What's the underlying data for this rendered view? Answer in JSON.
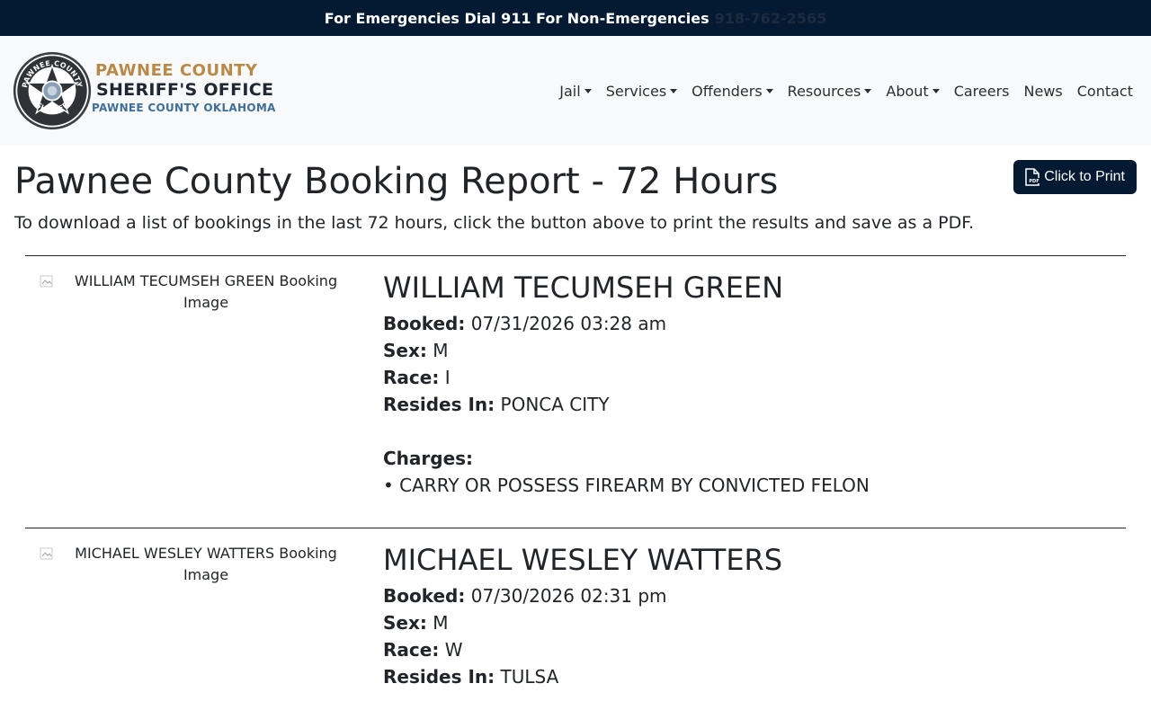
{
  "topbar": {
    "emergency_text": "For Emergencies Dial 911 For Non-Emergencies",
    "phone": "918-762-2565"
  },
  "brand": {
    "line1": "PAWNEE COUNTY",
    "line2": "SHERIFF'S OFFICE",
    "line3": "PAWNEE COUNTY OKLAHOMA",
    "seal_text_top": "PAWNEE COUNTY",
    "seal_text_bottom": "SHERIFF"
  },
  "nav": {
    "items": [
      {
        "label": "Jail",
        "dropdown": true
      },
      {
        "label": "Services",
        "dropdown": true
      },
      {
        "label": "Offenders",
        "dropdown": true
      },
      {
        "label": "Resources",
        "dropdown": true
      },
      {
        "label": "About",
        "dropdown": true
      },
      {
        "label": "Careers",
        "dropdown": false
      },
      {
        "label": "News",
        "dropdown": false
      },
      {
        "label": "Contact",
        "dropdown": false
      }
    ]
  },
  "page": {
    "title": "Pawnee County Booking Report - 72 Hours",
    "print_button": "Click to Print",
    "instructions": "To download a list of bookings in the last 72 hours, click the button above to print the results and save as a PDF."
  },
  "labels": {
    "booked": "Booked:",
    "sex": "Sex:",
    "race": "Race:",
    "resides": "Resides In:",
    "charges": "Charges:"
  },
  "records": [
    {
      "image_alt": "WILLIAM TECUMSEH GREEN Booking Image",
      "name": "WILLIAM TECUMSEH GREEN",
      "booked": "07/31/2026 03:28 am",
      "sex": "M",
      "race": "I",
      "resides": "PONCA CITY",
      "charges": [
        "• CARRY OR POSSESS FIREARM BY CONVICTED FELON"
      ]
    },
    {
      "image_alt": "MICHAEL WESLEY WATTERS Booking Image",
      "name": "MICHAEL WESLEY WATTERS",
      "booked": "07/30/2026 02:31 pm",
      "sex": "M",
      "race": "W",
      "resides": "TULSA",
      "charges": []
    }
  ],
  "colors": {
    "navy": "#041a33",
    "gold": "#b98948",
    "steel_blue": "#3f6e97"
  }
}
